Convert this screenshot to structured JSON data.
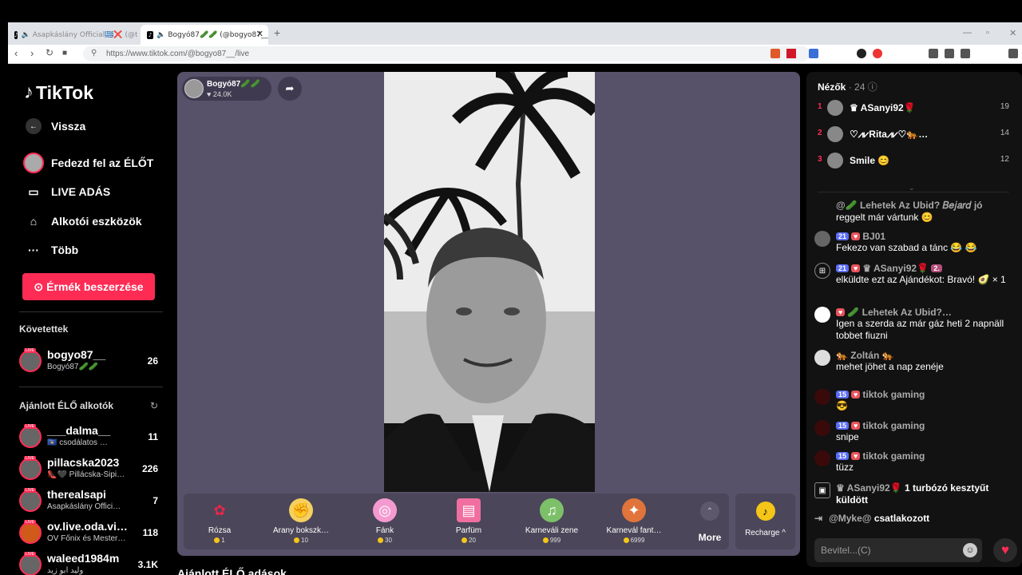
{
  "browser": {
    "tabs": [
      {
        "label": "Asapkáslány Official🇬🇷❌ (@the…"
      },
      {
        "label": "Bogyó87🥒🥒 (@bogyo87__"
      }
    ],
    "new_tab": "+",
    "url": "https://www.tiktok.com/@bogyo87__/live"
  },
  "sidebar": {
    "logo": "TikTok",
    "menu": [
      {
        "label": "Vissza",
        "icon": "back-arrow-icon"
      },
      {
        "label": "Fedezd fel az ÉLŐT",
        "icon": "avatar"
      },
      {
        "label": "LIVE ADÁS",
        "icon": "camera-icon"
      },
      {
        "label": "Alkotói eszközök",
        "icon": "creator-icon"
      },
      {
        "label": "Több",
        "icon": "more-dots-icon"
      }
    ],
    "coins_button": "Érmék beszerzése",
    "following_title": "Követettek",
    "following": [
      {
        "name": "bogyo87__",
        "sub": "Bogyó87🥒🥒",
        "count": "26"
      }
    ],
    "suggested_title": "Ajánlott ÉLŐ alkotók",
    "suggested": [
      {
        "name": "___dalma__",
        "sub": "🇽🇰 csodálatos …",
        "count": "11"
      },
      {
        "name": "pillacska2023",
        "sub": "👠🖤 Pillácska-Sipi…",
        "count": "226"
      },
      {
        "name": "therealsapi",
        "sub": "Asapkáslány Offici…",
        "count": "7"
      },
      {
        "name": "ov.live.oda.vi…",
        "sub": "OV Főnix és Mester…",
        "count": "118"
      },
      {
        "name": "waleed1984m",
        "sub": "وليد ابو زيد",
        "count": "3.1K"
      }
    ],
    "bottom_title": "Ajánlott ÉLŐ adások"
  },
  "stream": {
    "host_name": "Bogyó87🥒🥒",
    "likes": "24.0K",
    "gifts": [
      {
        "name": "Rózsa",
        "price": "1",
        "icon": "rose-icon"
      },
      {
        "name": "Arany bokszk…",
        "price": "10",
        "icon": "gold-glove-icon"
      },
      {
        "name": "Fánk",
        "price": "30",
        "icon": "donut-icon"
      },
      {
        "name": "Parfüm",
        "price": "20",
        "icon": "perfume-icon"
      },
      {
        "name": "Karneváli zene",
        "price": "999",
        "icon": "carnival-music-icon"
      },
      {
        "name": "Karnevál fant…",
        "price": "6999",
        "icon": "carnival-fantasy-icon"
      }
    ],
    "more_label": "More",
    "recharge_label": "Recharge ^"
  },
  "chat": {
    "viewers_label": "Nézők",
    "viewers_count": "· 24",
    "top": [
      {
        "rank": "1",
        "name": "♛ ASanyi92🌹",
        "score": "19"
      },
      {
        "rank": "2",
        "name": "♡⩘⩗Rita⩘⩗♡🐅…",
        "score": "14"
      },
      {
        "rank": "3",
        "name": "Smile 😊",
        "score": "12"
      }
    ],
    "messages": [
      {
        "header": "@🥒 Lehetek Az Ubid? 𝐵𝑒𝑗𝑎𝑟𝑑 jó",
        "text": "reggelt már vártunk 😊"
      },
      {
        "badges": [
          "21"
        ],
        "header": "BJ01",
        "text": "Fekezo van szabad a tánc 😂 😂"
      },
      {
        "badges": [
          "21"
        ],
        "header": "♛ ASanyi92🌹",
        "extra": "2.",
        "text": "elküldte ezt az Ajándékot: Bravó! 🥑 × 1"
      },
      {
        "header": "🥒 Lehetek Az Ubid?…",
        "text": "Igen a szerda az már gáz heti 2 napnäll tobbet fiuzni"
      },
      {
        "header": "🐅 Zoltán 🐅",
        "text": "mehet jöhet a nap zenéje"
      },
      {
        "badges": [
          "15"
        ],
        "header": "tiktok gaming",
        "text": "😎"
      },
      {
        "badges": [
          "15"
        ],
        "header": "tiktok gaming",
        "text": "snipe"
      },
      {
        "badges": [
          "15"
        ],
        "header": "tiktok gaming",
        "text": "tüzz"
      },
      {
        "header": "♛ ASanyi92🌹",
        "text": "1 turbózó kesztyűt küldött"
      }
    ],
    "join_user": "@Myke@",
    "join_text": "csatlakozott",
    "input_placeholder": "Bevitel...(C)"
  }
}
